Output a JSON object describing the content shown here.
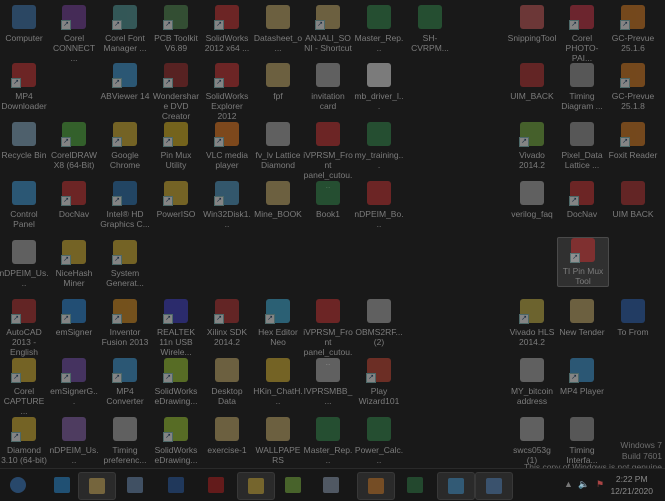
{
  "desktop": {
    "icons": [
      {
        "label": "Computer",
        "color": "#3a6ea0",
        "shortcut": false
      },
      {
        "label": "Corel CONNECT ...",
        "color": "#6a3a8a",
        "shortcut": true
      },
      {
        "label": "Corel Font Manager ...",
        "color": "#4a8a8a",
        "shortcut": true
      },
      {
        "label": "PCB Toolkit V6.89",
        "color": "#4a7a4a",
        "shortcut": true
      },
      {
        "label": "SolidWorks 2012 x64 ...",
        "color": "#b03030",
        "shortcut": true
      },
      {
        "label": "Datasheet_o...",
        "color": "#b09a60",
        "shortcut": false
      },
      {
        "label": "ANJALI_SONI - Shortcut",
        "color": "#b09a60",
        "shortcut": true
      },
      {
        "label": "Master_Rep...",
        "color": "#2f7a45",
        "shortcut": false
      },
      {
        "label": "SH-CVRPM...",
        "color": "#2f7a45",
        "shortcut": false
      },
      {
        "label": "SnippingTool",
        "color": "#b05050",
        "shortcut": false
      },
      {
        "label": "Corel PHOTO-PAI...",
        "color": "#b03040",
        "shortcut": true
      },
      {
        "label": "GC-Prevue 25.1.6",
        "color": "#c07020",
        "shortcut": true
      },
      {
        "label": "MP4 Downloader",
        "color": "#b03030",
        "shortcut": true
      },
      {
        "label": "ABViewer 14",
        "color": "#3a8ac0",
        "shortcut": true
      },
      {
        "label": "Wondershare DVD Creator",
        "color": "#8a2a2a",
        "shortcut": true
      },
      {
        "label": "SolidWorks Explorer 2012",
        "color": "#b03030",
        "shortcut": true
      },
      {
        "label": "fpf",
        "color": "#b09a60",
        "shortcut": false
      },
      {
        "label": "invitation card",
        "color": "#9a9a9a",
        "shortcut": false
      },
      {
        "label": "mb_driver_l...",
        "color": "#cccccc",
        "shortcut": false
      },
      {
        "label": "UIM_BACK",
        "color": "#a03030",
        "shortcut": false
      },
      {
        "label": "Timing Diagram ...",
        "color": "#8a8a8a",
        "shortcut": false
      },
      {
        "label": "GC-Prevue 25.1.8",
        "color": "#c07020",
        "shortcut": true
      },
      {
        "label": "Recycle Bin",
        "color": "#7a9ab0",
        "shortcut": false
      },
      {
        "label": "CorelDRAW X8 (64-Bit)",
        "color": "#4a9a3a",
        "shortcut": true
      },
      {
        "label": "Google Chrome",
        "color": "#c0a030",
        "shortcut": true
      },
      {
        "label": "Pin Mux Utility",
        "color": "#c0a020",
        "shortcut": true
      },
      {
        "label": "VLC media player",
        "color": "#d07020",
        "shortcut": true
      },
      {
        "label": "fv_lv Lattice Diamond",
        "color": "#9a9a9a",
        "shortcut": false
      },
      {
        "label": "iVPRSM_Front panel_cutou...",
        "color": "#b03030",
        "shortcut": false
      },
      {
        "label": "my_training...",
        "color": "#2f7a45",
        "shortcut": false
      },
      {
        "label": "Vivado 2014.2",
        "color": "#6a9a3a",
        "shortcut": true
      },
      {
        "label": "Pixel_Data Lattice ...",
        "color": "#8a8a8a",
        "shortcut": false
      },
      {
        "label": "Foxit Reader",
        "color": "#c07020",
        "shortcut": true
      },
      {
        "label": "Control Panel",
        "color": "#3a8ac0",
        "shortcut": false
      },
      {
        "label": "DocNav",
        "color": "#b03030",
        "shortcut": true
      },
      {
        "label": "Intel® HD Graphics C...",
        "color": "#2a6aa0",
        "shortcut": true
      },
      {
        "label": "PowerISO",
        "color": "#c0a030",
        "shortcut": true
      },
      {
        "label": "Win32Disk1...",
        "color": "#4a8ab0",
        "shortcut": true
      },
      {
        "label": "Mine_BOOK",
        "color": "#b09a60",
        "shortcut": false
      },
      {
        "label": "Book1",
        "color": "#2f7a45",
        "shortcut": false
      },
      {
        "label": "nDPEIM_Bo...",
        "color": "#b03030",
        "shortcut": false
      },
      {
        "label": "verilog_faq",
        "color": "#9a9a9a",
        "shortcut": false
      },
      {
        "label": "DocNav",
        "color": "#b03030",
        "shortcut": true
      },
      {
        "label": "UIM BACK",
        "color": "#a03030",
        "shortcut": false
      },
      {
        "label": "nDPEIM_Us...",
        "color": "#9a9a9a",
        "shortcut": false
      },
      {
        "label": "NiceHash Miner",
        "color": "#c0a030",
        "shortcut": true
      },
      {
        "label": "System Generat...",
        "color": "#c0a030",
        "shortcut": true
      },
      {
        "label": "TI Pin Mux Tool",
        "color": "#c03030",
        "shortcut": true,
        "selected": true
      },
      {
        "label": "AutoCAD 2013 - English",
        "color": "#a03030",
        "shortcut": true
      },
      {
        "label": "emSigner",
        "color": "#2a7ac0",
        "shortcut": true
      },
      {
        "label": "Inventor Fusion 2013",
        "color": "#c08020",
        "shortcut": true
      },
      {
        "label": "REALTEK 11n USB Wirele...",
        "color": "#3a3ab0",
        "shortcut": true
      },
      {
        "label": "Xilinx SDK 2014.2",
        "color": "#a03030",
        "shortcut": true
      },
      {
        "label": "Hex Editor Neo",
        "color": "#3a9ac0",
        "shortcut": true
      },
      {
        "label": "iVPRSM_Front panel_cutou...",
        "color": "#b03030",
        "shortcut": false
      },
      {
        "label": "OBMS2RF... (2)",
        "color": "#9a9a9a",
        "shortcut": false
      },
      {
        "label": "Vivado HLS 2014.2",
        "color": "#b0a040",
        "shortcut": true
      },
      {
        "label": "New Tender",
        "color": "#b09a60",
        "shortcut": false
      },
      {
        "label": "To From",
        "color": "#2a5aa0",
        "shortcut": false
      },
      {
        "label": "Corel CAPTURE ...",
        "color": "#c0a030",
        "shortcut": true
      },
      {
        "label": "emSignerG...",
        "color": "#6a4a9a",
        "shortcut": true
      },
      {
        "label": "MP4 Converter",
        "color": "#3a8ac0",
        "shortcut": true
      },
      {
        "label": "SolidWorks eDrawing...",
        "color": "#8ab030",
        "shortcut": true
      },
      {
        "label": "Desktop Data",
        "color": "#b09a60",
        "shortcut": false
      },
      {
        "label": "HKin_ChatH...",
        "color": "#c0a030",
        "shortcut": false
      },
      {
        "label": "IVPRSMBB_...",
        "color": "#9a9a9a",
        "shortcut": false
      },
      {
        "label": "Play Wizard101",
        "color": "#b04030",
        "shortcut": true
      },
      {
        "label": "MY_bitcoin address",
        "color": "#9a9a9a",
        "shortcut": false
      },
      {
        "label": "MP4 Player",
        "color": "#3a8ac0",
        "shortcut": true
      },
      {
        "label": "Diamond 3.10 (64-bit)",
        "color": "#c0a030",
        "shortcut": true
      },
      {
        "label": "nDPEIM_Us...",
        "color": "#7a5a9a",
        "shortcut": false
      },
      {
        "label": "Timing preferenc...",
        "color": "#9a9a9a",
        "shortcut": false
      },
      {
        "label": "SolidWorks eDrawing...",
        "color": "#8ab030",
        "shortcut": true
      },
      {
        "label": "exercise-1",
        "color": "#b09a60",
        "shortcut": false
      },
      {
        "label": "WALLPAPERS",
        "color": "#b09a60",
        "shortcut": false
      },
      {
        "label": "Master_Rep...",
        "color": "#2f7a45",
        "shortcut": false
      },
      {
        "label": "Power_Calc...",
        "color": "#2f7a45",
        "shortcut": false
      },
      {
        "label": "swcs053g (1)",
        "color": "#9a9a9a",
        "shortcut": false
      },
      {
        "label": "Timing Interfa...",
        "color": "#8a8a8a",
        "shortcut": false
      }
    ]
  },
  "watermark": {
    "line1": "Windows 7",
    "line2": "Build 7601",
    "line3": "This copy of Windows is not genuine"
  },
  "taskbar": {
    "buttons": [
      {
        "name": "start-button",
        "color": "#3a7ac0",
        "open": false
      },
      {
        "name": "internet-explorer",
        "color": "#2a8ad0",
        "open": false
      },
      {
        "name": "windows-explorer",
        "color": "#c0a050",
        "open": true
      },
      {
        "name": "notepad",
        "color": "#6a8ab0",
        "open": false
      },
      {
        "name": "microsoft-word",
        "color": "#2a5aa0",
        "open": false
      },
      {
        "name": "adobe-reader",
        "color": "#b02020",
        "open": false
      },
      {
        "name": "google-chrome",
        "color": "#c0a030",
        "open": true
      },
      {
        "name": "notepad-plus-plus",
        "color": "#7ab040",
        "open": false
      },
      {
        "name": "paint",
        "color": "#8a9ab0",
        "open": false
      },
      {
        "name": "foxit-reader",
        "color": "#c07020",
        "open": true
      },
      {
        "name": "microsoft-excel",
        "color": "#2f7a45",
        "open": false
      },
      {
        "name": "remote-desktop",
        "color": "#3a8ac0",
        "open": true
      },
      {
        "name": "photo-viewer",
        "color": "#4a7ab0",
        "open": true
      }
    ],
    "clock": {
      "time": "2:22 PM",
      "date": "12/21/2020"
    }
  }
}
